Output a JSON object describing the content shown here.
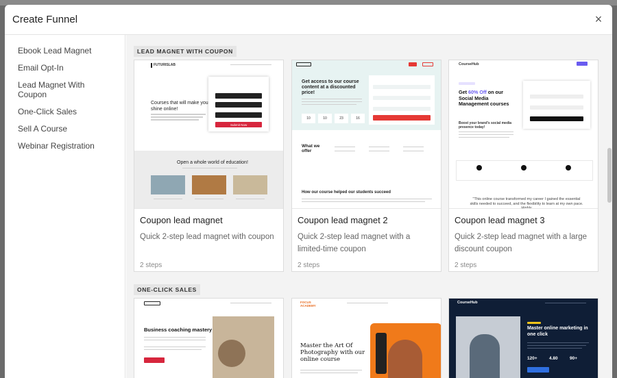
{
  "modal": {
    "title": "Create Funnel",
    "close_glyph": "×"
  },
  "sidebar": {
    "items": [
      {
        "label": "Ebook Lead Magnet"
      },
      {
        "label": "Email Opt-In"
      },
      {
        "label": "Lead Magnet With Coupon"
      },
      {
        "label": "One-Click Sales"
      },
      {
        "label": "Sell A Course"
      },
      {
        "label": "Webinar Registration"
      }
    ]
  },
  "sections": [
    {
      "label": "LEAD MAGNET WITH COUPON",
      "cards": [
        {
          "title": "Coupon lead magnet",
          "description": "Quick 2-step lead magnet with coupon",
          "steps": "2 steps",
          "preview": {
            "logo": "FUTURISLAB",
            "headline": "Courses that will make you shine online!",
            "button": "Submit Now",
            "subhead": "Open a whole world of  education!"
          }
        },
        {
          "title": "Coupon lead magnet 2",
          "description": "Quick 2-step lead magnet with a limited-time coupon",
          "steps": "2 steps",
          "preview": {
            "headline": "Get access to our course content at a discounted price!",
            "countdown": [
              "10",
              "10",
              "23",
              "16"
            ],
            "what": "What we offer",
            "how": "How our course helped our students succeed"
          }
        },
        {
          "title": "Coupon lead magnet 3",
          "description": "Quick 2-step lead magnet with a large discount coupon",
          "steps": "2 steps",
          "preview": {
            "logo": "CourseHub",
            "headline_pre": "Get ",
            "headline_accent": "60% Off",
            "headline_post": " on our Social Media Management courses",
            "tagline": "Boost your brand's social media presence today!",
            "quote": "\"This online course transformed my career I gained the essential skills needed to succeed, and the flexibility to learn at my own pace. Highly"
          }
        }
      ]
    },
    {
      "label": "ONE-CLICK SALES",
      "cards": [
        {
          "preview": {
            "headline": "Business coaching mastery"
          }
        },
        {
          "preview": {
            "logo": "FOCUS ACADEMY",
            "headline": "Master the Art Of Photography with our online course"
          }
        },
        {
          "preview": {
            "logo": "CourseHub",
            "headline": "Master online marketing in one click",
            "stats": [
              "120+",
              "4.80",
              "90+"
            ]
          }
        }
      ]
    }
  ]
}
